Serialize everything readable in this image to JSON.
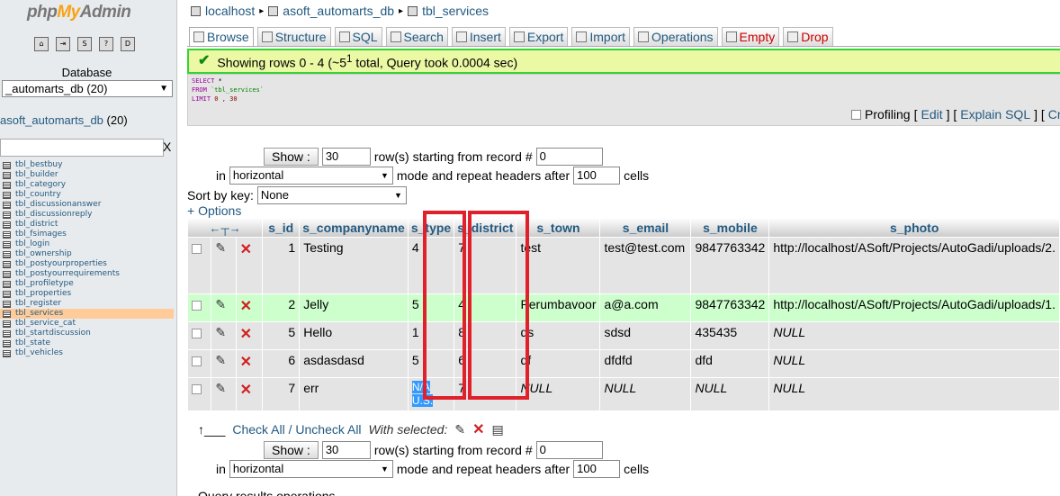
{
  "sidebar": {
    "logo_php": "php",
    "logo_my": "My",
    "logo_admin": "Admin",
    "db_label": "Database",
    "db_select": "_automarts_db (20)",
    "db_title": "asoft_automarts_db",
    "db_count": "(20)",
    "filter_clear": "X",
    "tables": [
      "tbl_bestbuy",
      "tbl_builder",
      "tbl_category",
      "tbl_country",
      "tbl_discussionanswer",
      "tbl_discussionreply",
      "tbl_district",
      "tbl_fsimages",
      "tbl_login",
      "tbl_ownership",
      "tbl_postyourproperties",
      "tbl_postyourrequirements",
      "tbl_profiletype",
      "tbl_properties",
      "tbl_register",
      "tbl_services",
      "tbl_service_cat",
      "tbl_startdiscussion",
      "tbl_state",
      "tbl_vehicles"
    ],
    "active_table": "tbl_services"
  },
  "breadcrumb": {
    "server": "localhost",
    "database": "asoft_automarts_db",
    "table": "tbl_services"
  },
  "tabs": {
    "browse": "Browse",
    "structure": "Structure",
    "sql": "SQL",
    "search": "Search",
    "insert": "Insert",
    "export": "Export",
    "import": "Import",
    "operations": "Operations",
    "empty": "Empty",
    "drop": "Drop"
  },
  "message": {
    "text": "Showing rows 0 - 4 (~5",
    "sup": "1",
    "text2": " total, Query took 0.0004 sec)"
  },
  "sql": {
    "line1_kw": "SELECT",
    "line1_rest": " *",
    "line2_kw": "FROM",
    "line2_rest": " `tbl_services`",
    "line3_kw": "LIMIT",
    "line3_rest": " 0 , 30"
  },
  "profiling": {
    "label": "Profiling",
    "edit": "Edit",
    "explain": "Explain SQL",
    "create": "Cre"
  },
  "nav": {
    "show_label": "Show :",
    "rows_value": "30",
    "rows_text": "row(s) starting from record #",
    "start_value": "0",
    "in_label": "in",
    "mode_value": "horizontal",
    "mode_text": "mode and repeat headers after",
    "repeat_value": "100",
    "cells_text": "cells",
    "sortkey_label": "Sort by key:",
    "sortkey_value": "None",
    "options_link": "+ Options"
  },
  "table": {
    "columns": [
      "s_id",
      "s_companyname",
      "s_type",
      "s_district",
      "s_town",
      "s_email",
      "s_mobile",
      "s_photo"
    ],
    "rows": [
      {
        "s_id": "1",
        "s_companyname": "Testing",
        "s_type": "4",
        "s_district": "7",
        "s_town": "test",
        "s_email": "test@test.com",
        "s_mobile": "9847763342",
        "s_photo": "http://localhost/ASoft/Projects/AutoGadi/uploads/2."
      },
      {
        "s_id": "2",
        "s_companyname": "Jelly",
        "s_type": "5",
        "s_district": "4",
        "s_town": "Perumbavoor",
        "s_email": "a@a.com",
        "s_mobile": "9847763342",
        "s_photo": "http://localhost/ASoft/Projects/AutoGadi/uploads/1."
      },
      {
        "s_id": "5",
        "s_companyname": "Hello",
        "s_type": "1",
        "s_district": "8",
        "s_town": "ds",
        "s_email": "sdsd",
        "s_mobile": "435435",
        "s_photo": "NULL"
      },
      {
        "s_id": "6",
        "s_companyname": "asdasdasd",
        "s_type": "5",
        "s_district": "6",
        "s_town": "df",
        "s_email": "dfdfd",
        "s_mobile": "dfd",
        "s_photo": "NULL"
      },
      {
        "s_id": "7",
        "s_companyname": "err",
        "s_type": "N/A U.S.",
        "s_district": "7",
        "s_town": "NULL",
        "s_email": "NULL",
        "s_mobile": "NULL",
        "s_photo": "NULL"
      }
    ]
  },
  "bulk": {
    "check_all": "Check All",
    "slash": " / ",
    "uncheck_all": "Uncheck All",
    "with_selected": "With selected:"
  },
  "bottom": {
    "text": "Query results operations"
  }
}
